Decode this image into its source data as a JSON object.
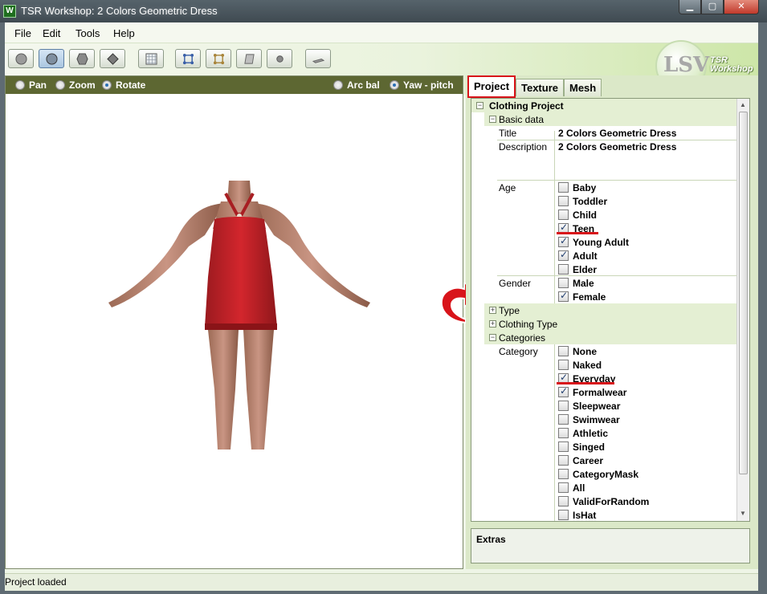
{
  "window": {
    "title": "TSR Workshop: 2 Colors Geometric Dress",
    "app_icon": "W",
    "controls": [
      "minimize-icon",
      "maximize-icon",
      "close-icon"
    ]
  },
  "menu": {
    "items": [
      "File",
      "Edit",
      "Tools",
      "Help"
    ]
  },
  "toolbar": {
    "buttons": [
      "sphere-icon",
      "circle-icon",
      "hexagon-icon",
      "diamond-icon",
      "grid-icon",
      "bones-icon",
      "bones-alt-icon",
      "plane-icon",
      "dot-icon",
      "flat-icon"
    ],
    "logo": {
      "letters": "LSV",
      "text_line1": "TSR",
      "text_line2": "Workshop"
    }
  },
  "viewport": {
    "nav_modes": [
      "Pan",
      "Zoom",
      "Rotate"
    ],
    "selected_nav": "Rotate",
    "rotate_modes": [
      "Arc bal",
      "Yaw - pitch"
    ],
    "selected_rotate": "Yaw - pitch",
    "dress_color": "#d3262d"
  },
  "tabs": [
    "Project",
    "Texture",
    "Mesh"
  ],
  "active_tab": "Project",
  "project": {
    "root": "Clothing Project",
    "basic_data": "Basic data",
    "title_label": "Title",
    "title_value": "2 Colors Geometric Dress",
    "description_label": "Description",
    "description_value": "2 Colors Geometric Dress",
    "age_label": "Age",
    "ages": [
      {
        "label": "Baby",
        "checked": false
      },
      {
        "label": "Toddler",
        "checked": false
      },
      {
        "label": "Child",
        "checked": false
      },
      {
        "label": "Teen",
        "checked": true
      },
      {
        "label": "Young Adult",
        "checked": true
      },
      {
        "label": "Adult",
        "checked": true
      },
      {
        "label": "Elder",
        "checked": false
      }
    ],
    "gender_label": "Gender",
    "genders": [
      {
        "label": "Male",
        "checked": false
      },
      {
        "label": "Female",
        "checked": true
      }
    ],
    "type_section": "Type",
    "clothing_type_section": "Clothing Type",
    "categories_section": "Categories",
    "category_label": "Category",
    "categories": [
      {
        "label": "None",
        "checked": false
      },
      {
        "label": "Naked",
        "checked": false
      },
      {
        "label": "Everyday",
        "checked": true
      },
      {
        "label": "Formalwear",
        "checked": true
      },
      {
        "label": "Sleepwear",
        "checked": false
      },
      {
        "label": "Swimwear",
        "checked": false
      },
      {
        "label": "Athletic",
        "checked": false
      },
      {
        "label": "Singed",
        "checked": false
      },
      {
        "label": "Career",
        "checked": false
      },
      {
        "label": "CategoryMask",
        "checked": false
      },
      {
        "label": "All",
        "checked": false
      },
      {
        "label": "ValidForRandom",
        "checked": false
      },
      {
        "label": "IsHat",
        "checked": false
      }
    ]
  },
  "extras": {
    "label": "Extras"
  },
  "status": {
    "text": "Project loaded"
  },
  "colors": {
    "accent": "#d8141a",
    "panel": "#dbe8c8",
    "viewport_bar": "#5d6732"
  }
}
